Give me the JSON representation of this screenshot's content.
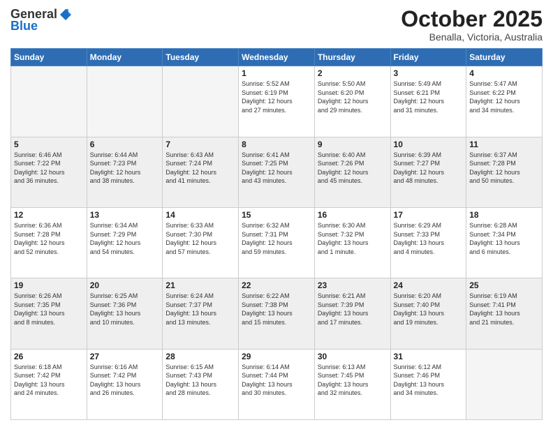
{
  "header": {
    "logo_general": "General",
    "logo_blue": "Blue",
    "month_year": "October 2025",
    "location": "Benalla, Victoria, Australia"
  },
  "weekdays": [
    "Sunday",
    "Monday",
    "Tuesday",
    "Wednesday",
    "Thursday",
    "Friday",
    "Saturday"
  ],
  "weeks": [
    [
      {
        "day": "",
        "info": ""
      },
      {
        "day": "",
        "info": ""
      },
      {
        "day": "",
        "info": ""
      },
      {
        "day": "1",
        "info": "Sunrise: 5:52 AM\nSunset: 6:19 PM\nDaylight: 12 hours\nand 27 minutes."
      },
      {
        "day": "2",
        "info": "Sunrise: 5:50 AM\nSunset: 6:20 PM\nDaylight: 12 hours\nand 29 minutes."
      },
      {
        "day": "3",
        "info": "Sunrise: 5:49 AM\nSunset: 6:21 PM\nDaylight: 12 hours\nand 31 minutes."
      },
      {
        "day": "4",
        "info": "Sunrise: 5:47 AM\nSunset: 6:22 PM\nDaylight: 12 hours\nand 34 minutes."
      }
    ],
    [
      {
        "day": "5",
        "info": "Sunrise: 6:46 AM\nSunset: 7:22 PM\nDaylight: 12 hours\nand 36 minutes."
      },
      {
        "day": "6",
        "info": "Sunrise: 6:44 AM\nSunset: 7:23 PM\nDaylight: 12 hours\nand 38 minutes."
      },
      {
        "day": "7",
        "info": "Sunrise: 6:43 AM\nSunset: 7:24 PM\nDaylight: 12 hours\nand 41 minutes."
      },
      {
        "day": "8",
        "info": "Sunrise: 6:41 AM\nSunset: 7:25 PM\nDaylight: 12 hours\nand 43 minutes."
      },
      {
        "day": "9",
        "info": "Sunrise: 6:40 AM\nSunset: 7:26 PM\nDaylight: 12 hours\nand 45 minutes."
      },
      {
        "day": "10",
        "info": "Sunrise: 6:39 AM\nSunset: 7:27 PM\nDaylight: 12 hours\nand 48 minutes."
      },
      {
        "day": "11",
        "info": "Sunrise: 6:37 AM\nSunset: 7:28 PM\nDaylight: 12 hours\nand 50 minutes."
      }
    ],
    [
      {
        "day": "12",
        "info": "Sunrise: 6:36 AM\nSunset: 7:28 PM\nDaylight: 12 hours\nand 52 minutes."
      },
      {
        "day": "13",
        "info": "Sunrise: 6:34 AM\nSunset: 7:29 PM\nDaylight: 12 hours\nand 54 minutes."
      },
      {
        "day": "14",
        "info": "Sunrise: 6:33 AM\nSunset: 7:30 PM\nDaylight: 12 hours\nand 57 minutes."
      },
      {
        "day": "15",
        "info": "Sunrise: 6:32 AM\nSunset: 7:31 PM\nDaylight: 12 hours\nand 59 minutes."
      },
      {
        "day": "16",
        "info": "Sunrise: 6:30 AM\nSunset: 7:32 PM\nDaylight: 13 hours\nand 1 minute."
      },
      {
        "day": "17",
        "info": "Sunrise: 6:29 AM\nSunset: 7:33 PM\nDaylight: 13 hours\nand 4 minutes."
      },
      {
        "day": "18",
        "info": "Sunrise: 6:28 AM\nSunset: 7:34 PM\nDaylight: 13 hours\nand 6 minutes."
      }
    ],
    [
      {
        "day": "19",
        "info": "Sunrise: 6:26 AM\nSunset: 7:35 PM\nDaylight: 13 hours\nand 8 minutes."
      },
      {
        "day": "20",
        "info": "Sunrise: 6:25 AM\nSunset: 7:36 PM\nDaylight: 13 hours\nand 10 minutes."
      },
      {
        "day": "21",
        "info": "Sunrise: 6:24 AM\nSunset: 7:37 PM\nDaylight: 13 hours\nand 13 minutes."
      },
      {
        "day": "22",
        "info": "Sunrise: 6:22 AM\nSunset: 7:38 PM\nDaylight: 13 hours\nand 15 minutes."
      },
      {
        "day": "23",
        "info": "Sunrise: 6:21 AM\nSunset: 7:39 PM\nDaylight: 13 hours\nand 17 minutes."
      },
      {
        "day": "24",
        "info": "Sunrise: 6:20 AM\nSunset: 7:40 PM\nDaylight: 13 hours\nand 19 minutes."
      },
      {
        "day": "25",
        "info": "Sunrise: 6:19 AM\nSunset: 7:41 PM\nDaylight: 13 hours\nand 21 minutes."
      }
    ],
    [
      {
        "day": "26",
        "info": "Sunrise: 6:18 AM\nSunset: 7:42 PM\nDaylight: 13 hours\nand 24 minutes."
      },
      {
        "day": "27",
        "info": "Sunrise: 6:16 AM\nSunset: 7:42 PM\nDaylight: 13 hours\nand 26 minutes."
      },
      {
        "day": "28",
        "info": "Sunrise: 6:15 AM\nSunset: 7:43 PM\nDaylight: 13 hours\nand 28 minutes."
      },
      {
        "day": "29",
        "info": "Sunrise: 6:14 AM\nSunset: 7:44 PM\nDaylight: 13 hours\nand 30 minutes."
      },
      {
        "day": "30",
        "info": "Sunrise: 6:13 AM\nSunset: 7:45 PM\nDaylight: 13 hours\nand 32 minutes."
      },
      {
        "day": "31",
        "info": "Sunrise: 6:12 AM\nSunset: 7:46 PM\nDaylight: 13 hours\nand 34 minutes."
      },
      {
        "day": "",
        "info": ""
      }
    ]
  ]
}
